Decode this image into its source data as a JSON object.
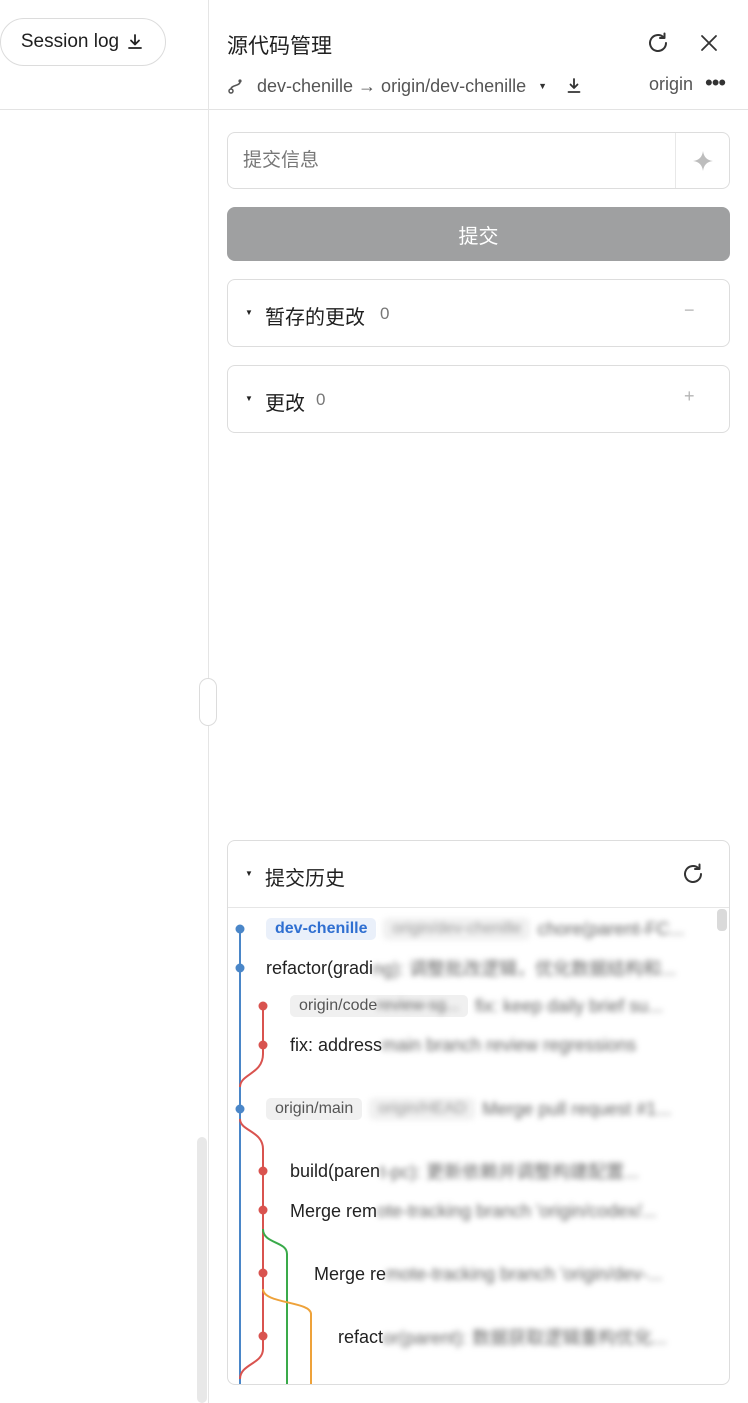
{
  "left": {
    "session_button": "Session log"
  },
  "header": {
    "title": "源代码管理",
    "branch_label": "dev-chenille → origin/dev-chenille",
    "remote": "origin"
  },
  "commit": {
    "placeholder": "提交信息",
    "button_label": "提交"
  },
  "sections": {
    "staged": {
      "label": "暂存的更改",
      "count": "0",
      "action": "−"
    },
    "changes": {
      "label": "更改",
      "count": "0",
      "action": "+"
    }
  },
  "history": {
    "label": "提交历史",
    "commits": [
      {
        "refs": [
          "dev-chenille"
        ],
        "refs_blurred": [
          "origin/dev-chenille"
        ],
        "message": "",
        "message_blurred": "chore(parent-FC..."
      },
      {
        "refs": [],
        "refs_blurred": [],
        "message": "refactor(gradi",
        "message_blurred": "ng): 调整批改逻辑，优化数据结构和..."
      },
      {
        "refs": [
          "origin/code"
        ],
        "refs_blurred": [
          "review-sg..."
        ],
        "message": "",
        "message_blurred": "fix: keep daily brief su..."
      },
      {
        "refs": [],
        "refs_blurred": [],
        "message": "fix: address",
        "message_blurred": "main branch review regressions"
      },
      {
        "refs": [
          "origin/main"
        ],
        "refs_blurred": [
          "origin/HEAD"
        ],
        "message": "",
        "message_blurred": "Merge pull request #1..."
      },
      {
        "refs": [],
        "refs_blurred": [],
        "message": "build(paren",
        "message_blurred": "t-pc): 更新依赖并调整构建配置..."
      },
      {
        "refs": [],
        "refs_blurred": [],
        "message": "Merge rem",
        "message_blurred": "ote-tracking branch 'origin/codex/..."
      },
      {
        "refs": [],
        "refs_blurred": [],
        "message": "Merge re",
        "message_blurred": "mote-tracking branch 'origin/dev-..."
      },
      {
        "refs": [],
        "refs_blurred": [],
        "message": "refact",
        "message_blurred": "or(parent): 数据获取逻辑重构优化..."
      }
    ]
  },
  "colors": {
    "blue_lane": "#4a86c8",
    "red_lane": "#d9534f",
    "green_lane": "#3aaa4a",
    "orange_lane": "#eea23a",
    "commit_button": "#9fa0a1",
    "head_tag_text": "#2f6fd1"
  },
  "icons": {
    "session": "download-icon",
    "refresh": "refresh-icon",
    "close": "close-icon",
    "branch": "git-branch-icon",
    "pull": "download-icon",
    "more": "more-horizontal-icon",
    "ai": "sparkle-icon"
  }
}
